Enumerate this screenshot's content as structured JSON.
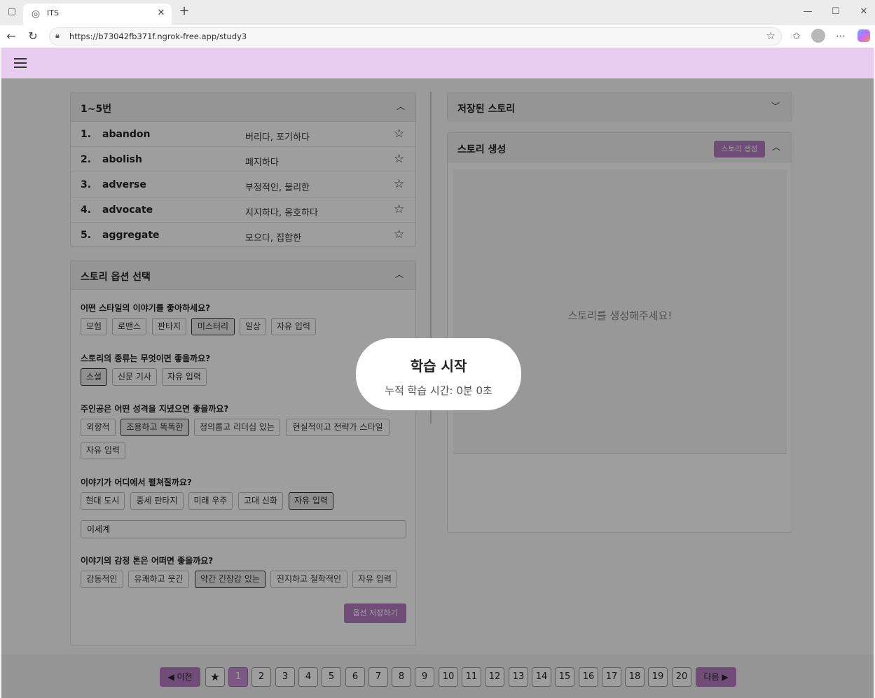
{
  "browser": {
    "tab_title": "ITS",
    "url": "https://b73042fb371f.ngrok-free.app/study3"
  },
  "word_panel": {
    "title": "1~5번",
    "words": [
      {
        "num": "1.",
        "word": "abandon",
        "meaning": "버리다, 포기하다"
      },
      {
        "num": "2.",
        "word": "abolish",
        "meaning": "폐지하다"
      },
      {
        "num": "3.",
        "word": "adverse",
        "meaning": "부정적인, 불리한"
      },
      {
        "num": "4.",
        "word": "advocate",
        "meaning": "지지하다, 옹호하다"
      },
      {
        "num": "5.",
        "word": "aggregate",
        "meaning": "모으다, 집합한"
      }
    ]
  },
  "options_panel": {
    "title": "스토리 옵션 선택",
    "questions": [
      {
        "q": "어떤 스타일의 이야기를 좋아하세요?",
        "chips": [
          "모험",
          "로맨스",
          "판타지",
          "미스터리",
          "일상",
          "자유 입력"
        ],
        "selected": "미스터리"
      },
      {
        "q": "스토리의 종류는 무엇이면 좋을까요?",
        "chips": [
          "소설",
          "신문 기사",
          "자유 입력"
        ],
        "selected": "소설"
      },
      {
        "q": "주인공은 어떤 성격을 지녔으면 좋을까요?",
        "chips": [
          "외향적",
          "조용하고 똑똑한",
          "정의롭고 리더십 있는",
          "현실적이고 전략가 스타일",
          "자유 입력"
        ],
        "selected": "조용하고 똑똑한"
      },
      {
        "q": "이야기가 어디에서 펼쳐질까요?",
        "chips": [
          "현대 도시",
          "중세 판타지",
          "미래 우주",
          "고대 신화",
          "자유 입력"
        ],
        "selected": "자유 입력",
        "input_value": "이세계"
      },
      {
        "q": "이야기의 감정 톤은 어떠면 좋을까요?",
        "chips": [
          "감동적인",
          "유쾌하고 웃긴",
          "약간 긴장감 있는",
          "진지하고 철학적인",
          "자유 입력"
        ],
        "selected": "약간 긴장감 있는"
      }
    ],
    "save_label": "옵션 저장하기"
  },
  "saved_panel": {
    "title": "저장된 스토리"
  },
  "story_panel": {
    "title": "스토리 생성",
    "generate_label": "스토리 생성",
    "placeholder": "스토리를 생성해주세요!"
  },
  "pager": {
    "prev_label": "◀ 이전",
    "next_label": "다음 ▶",
    "pages": [
      "1",
      "2",
      "3",
      "4",
      "5",
      "6",
      "7",
      "8",
      "9",
      "10",
      "11",
      "12",
      "13",
      "14",
      "15",
      "16",
      "17",
      "18",
      "19",
      "20"
    ],
    "active_page": "1"
  },
  "modal": {
    "title": "학습 시작",
    "subtitle": "누적 학습 시간: 0분 0초"
  },
  "colors": {
    "appbar": "#e8ccf0",
    "accent": "#b57bc4",
    "active_page": "#c98fd6"
  }
}
